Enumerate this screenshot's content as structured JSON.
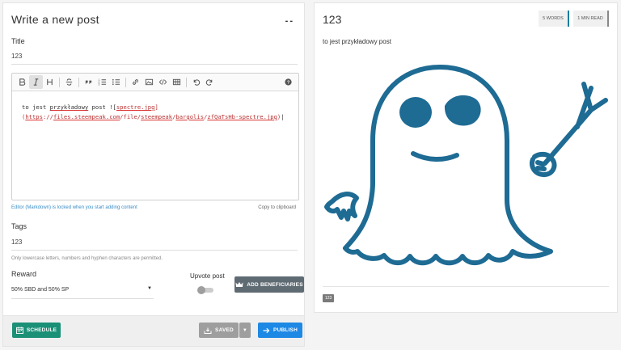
{
  "editor_panel": {
    "heading": "Write a new post",
    "collapse_label": "--",
    "title_label": "Title",
    "title_value": "123",
    "body_segments": {
      "p1": "to jest ",
      "p2": "przykładowy",
      "p3": " post ![",
      "p4": "spectre.jpg",
      "p5": "]",
      "p6": "(",
      "p7": "https",
      "p8": "://",
      "p9": "files.steempeak.com",
      "p10": "/file/",
      "p11": "steempeak",
      "p12": "/",
      "p13": "bargolis",
      "p14": "/",
      "p15": "zfQaTsHb-spectre.jpg",
      "p16": ")"
    },
    "locked_note": "Editor (Markdown) is locked when you start adding content",
    "copy_label": "Copy to clipboard",
    "tags_label": "Tags",
    "tags_value": "123",
    "tags_hint": "Only lowercase letters, numbers and hyphen characters are permitted.",
    "reward_label": "Reward",
    "reward_value": "50% SBD and 50% SP",
    "upvote_label": "Upvote post",
    "upvote_on": false,
    "beneficiaries_label": "ADD BENEFICIARIES",
    "schedule_label": "SCHEDULE",
    "saved_label": "SAVED",
    "publish_label": "PUBLISH",
    "toolbar_icons": [
      "bold-icon",
      "italic-icon",
      "heading-icon",
      "strikethrough-icon",
      "quote-icon",
      "ordered-list-icon",
      "unordered-list-icon",
      "link-icon",
      "image-icon",
      "code-icon",
      "table-icon",
      "undo-icon",
      "redo-icon",
      "help-icon"
    ]
  },
  "preview_panel": {
    "title": "123",
    "words_badge": "5 WORDS",
    "read_badge": "1 MIN READ",
    "body": "to jest przykładowy post",
    "image_subject": "spectre-ghost",
    "tag": "123"
  },
  "colors": {
    "ghost": "#1e6b94",
    "schedule": "#1a9077",
    "publish": "#1e88e5",
    "beneficiaries": "#5f6b73",
    "saved": "#9e9e9e",
    "link": "#3a8dc6"
  }
}
